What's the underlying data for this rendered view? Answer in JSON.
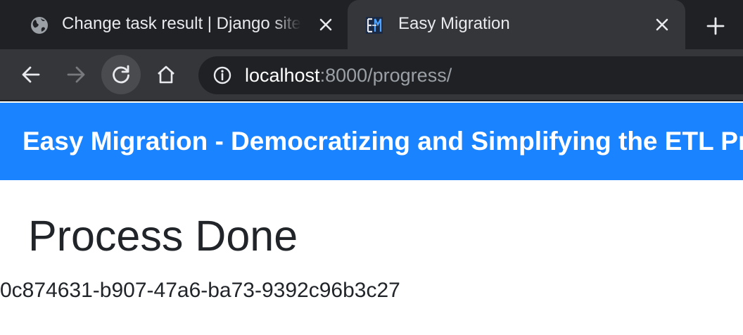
{
  "browser": {
    "tabs": [
      {
        "title": "Change task result | Django site admin",
        "icon": "globe-icon",
        "active": false
      },
      {
        "title": "Easy Migration",
        "icon": "em-logo-icon",
        "active": true
      }
    ],
    "new_tab_icon": "plus-icon",
    "address": {
      "host": "localhost",
      "path": ":8000/progress/",
      "security_icon": "info-icon"
    },
    "colors": {
      "frame": "#202124",
      "toolbar": "#35363a",
      "text": "#e8eaed"
    }
  },
  "page": {
    "navbar": {
      "brand": "Easy Migration - Democratizing and Simplifying the ETL Process",
      "color": "#1a83ff"
    },
    "title": "Process Done",
    "task_id": "0c874631-b907-47a6-ba73-9392c96b3c27"
  }
}
